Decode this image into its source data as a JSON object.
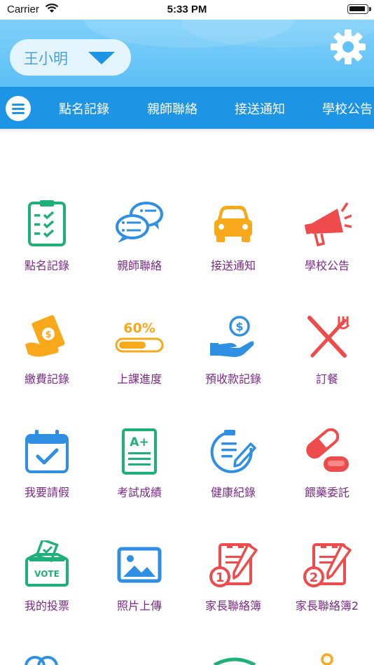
{
  "status_bar": {
    "carrier": "Carrier",
    "time": "5:33 PM"
  },
  "header": {
    "student_name": "王小明"
  },
  "tabs": [
    {
      "label": "點名記錄"
    },
    {
      "label": "親師聯絡"
    },
    {
      "label": "接送通知"
    },
    {
      "label": "學校公告"
    }
  ],
  "grid": [
    {
      "label": "點名記錄",
      "icon": "attendance-clipboard-icon"
    },
    {
      "label": "親師聯絡",
      "icon": "chat-bubbles-icon"
    },
    {
      "label": "接送通知",
      "icon": "car-icon"
    },
    {
      "label": "學校公告",
      "icon": "megaphone-icon"
    },
    {
      "label": "繳費記錄",
      "icon": "money-hand-icon"
    },
    {
      "label": "上課進度",
      "icon": "progress-60-icon",
      "progress_text": "60%"
    },
    {
      "label": "預收款記錄",
      "icon": "coin-hand-icon"
    },
    {
      "label": "訂餐",
      "icon": "fork-knife-icon"
    },
    {
      "label": "我要請假",
      "icon": "calendar-check-icon"
    },
    {
      "label": "考試成績",
      "icon": "grade-sheet-icon",
      "grade_text": "A+"
    },
    {
      "label": "健康紀錄",
      "icon": "clipboard-pen-icon"
    },
    {
      "label": "餵藥委託",
      "icon": "pill-capsule-icon"
    },
    {
      "label": "我的投票",
      "icon": "vote-box-icon",
      "vote_text": "VOTE"
    },
    {
      "label": "照片上傳",
      "icon": "photo-icon"
    },
    {
      "label": "家長聯絡簿",
      "icon": "notebook-1-icon",
      "badge": "1"
    },
    {
      "label": "家長聯絡簿2",
      "icon": "notebook-2-icon",
      "badge": "2"
    }
  ],
  "colors": {
    "primary_blue": "#1e94e5",
    "header_light": "#7fd0fa",
    "green": "#1fb07a",
    "orange": "#f7a81b",
    "red": "#ee4c4c",
    "icon_blue": "#2f8fe3",
    "label_purple": "#7a2a86"
  }
}
